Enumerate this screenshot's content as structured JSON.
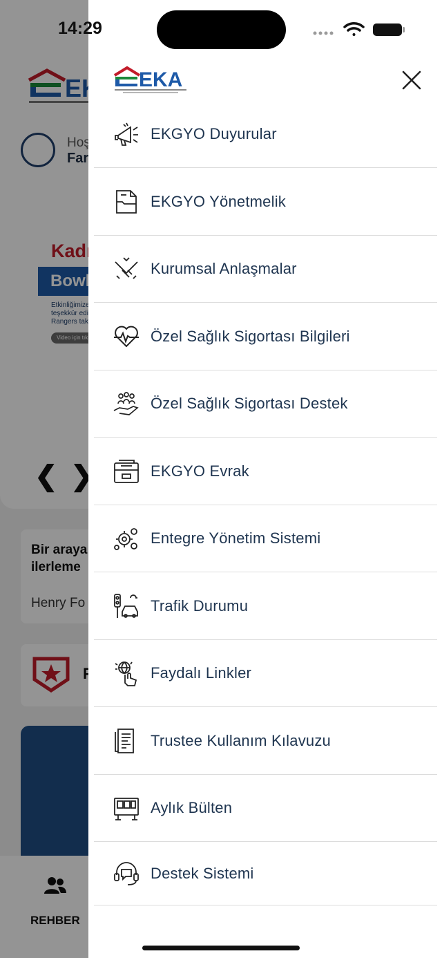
{
  "status_bar": {
    "time": "14:29"
  },
  "background": {
    "greeting": "Hoş",
    "name": "Far",
    "banner_title": "Kadın",
    "banner_button": "Bowli",
    "banner_text": "Etkinliğimize k\nteşekkür edi\nRangers takı",
    "banner_pill": "Video için tık",
    "quote": "Bir araya\nilerleme",
    "quote_author": "Henry Fo",
    "card_label": "F",
    "tab_rehber": "REHBER",
    "prev_arrow": "❮",
    "next_arrow": "❯"
  },
  "drawer": {
    "logo_text": "EKA",
    "menu": [
      {
        "label": "EKGYO Duyurular",
        "icon": "megaphone-icon"
      },
      {
        "label": "EKGYO Yönetmelik",
        "icon": "document-folder-icon"
      },
      {
        "label": "Kurumsal Anlaşmalar",
        "icon": "handshake-icon"
      },
      {
        "label": "Özel Sağlık Sigortası Bilgileri",
        "icon": "heart-pulse-icon"
      },
      {
        "label": "Özel Sağlık Sigortası Destek",
        "icon": "hand-people-icon"
      },
      {
        "label": "EKGYO Evrak",
        "icon": "file-cabinet-icon"
      },
      {
        "label": "Entegre Yönetim Sistemi",
        "icon": "gears-icon"
      },
      {
        "label": "Trafik Durumu",
        "icon": "traffic-car-icon"
      },
      {
        "label": "Faydalı Linkler",
        "icon": "globe-click-icon"
      },
      {
        "label": "Trustee Kullanım Kılavuzu",
        "icon": "manual-icon"
      },
      {
        "label": "Aylık Bülten",
        "icon": "bulletin-board-icon"
      },
      {
        "label": "Destek Sistemi",
        "icon": "headset-icon"
      }
    ]
  },
  "colors": {
    "primary_text": "#1f3550",
    "brand_blue": "#1e5aa8",
    "brand_red": "#c21c2a",
    "brand_green": "#1a8a3a"
  }
}
